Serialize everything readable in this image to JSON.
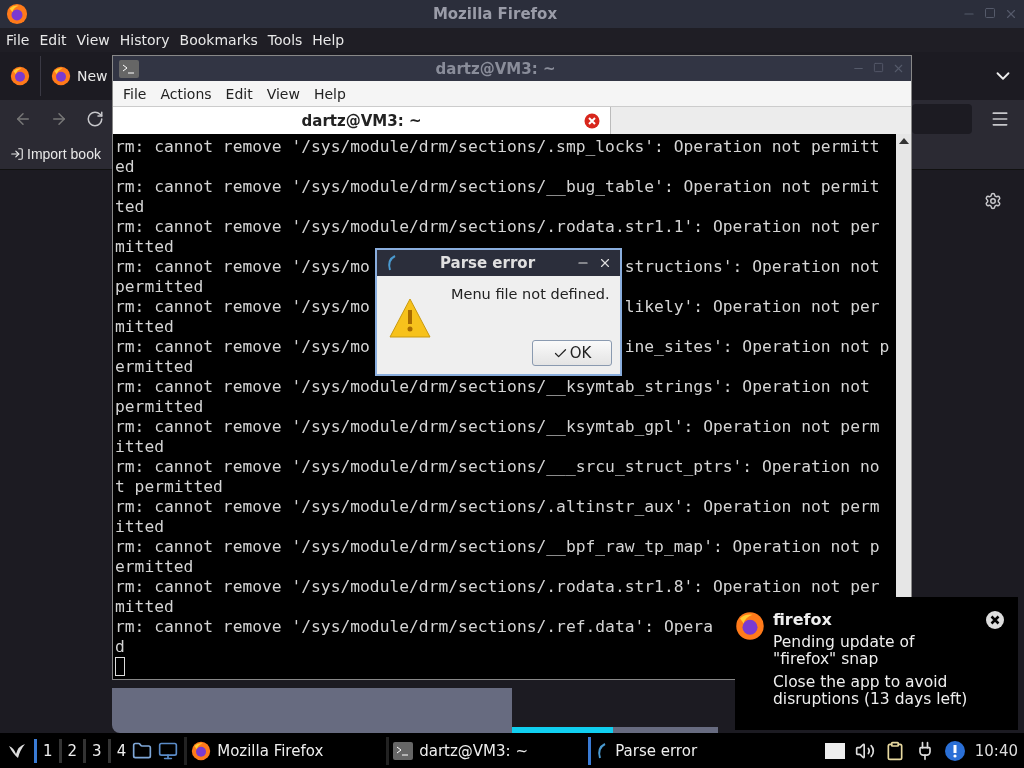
{
  "firefox": {
    "title": "Mozilla Firefox",
    "menu": [
      "File",
      "Edit",
      "View",
      "History",
      "Bookmarks",
      "Tools",
      "Help"
    ],
    "tab": {
      "label": "New"
    },
    "bookmark": "Import book",
    "progress": {
      "level": 0.49
    }
  },
  "terminal": {
    "title": "dartz@VM3: ~",
    "menu": [
      "File",
      "Actions",
      "Edit",
      "View",
      "Help"
    ],
    "tabs": [
      {
        "label": "dartz@VM3: ~",
        "selected": true
      }
    ],
    "lines": [
      {
        "text": "rm: cannot remove '/sys/module/drm/sections/.smp_locks': Operation not permitt"
      },
      {
        "text": "ed"
      },
      {
        "text": "rm: cannot remove '/sys/module/drm/sections/__bug_table': Operation not permit"
      },
      {
        "text": "ted"
      },
      {
        "text": "rm: cannot remove '/sys/module/drm/sections/.rodata.str1.1': Operation not per"
      },
      {
        "text": "mitted"
      },
      {
        "left": "rm: cannot remove '/sys/mo",
        "right": "structions': Operation not"
      },
      {
        "text": "permitted"
      },
      {
        "left": "rm: cannot remove '/sys/mo",
        "right": "likely': Operation not per"
      },
      {
        "text": "mitted"
      },
      {
        "left": "rm: cannot remove '/sys/mo",
        "right": "ine_sites': Operation not p"
      },
      {
        "text": "ermitted"
      },
      {
        "text": "rm: cannot remove '/sys/module/drm/sections/__ksymtab_strings': Operation not"
      },
      {
        "text": "permitted"
      },
      {
        "text": "rm: cannot remove '/sys/module/drm/sections/__ksymtab_gpl': Operation not perm"
      },
      {
        "text": "itted"
      },
      {
        "text": "rm: cannot remove '/sys/module/drm/sections/___srcu_struct_ptrs': Operation no"
      },
      {
        "text": "t permitted"
      },
      {
        "text": "rm: cannot remove '/sys/module/drm/sections/.altinstr_aux': Operation not perm"
      },
      {
        "text": "itted"
      },
      {
        "text": "rm: cannot remove '/sys/module/drm/sections/__bpf_raw_tp_map': Operation not p"
      },
      {
        "text": "ermitted"
      },
      {
        "text": "rm: cannot remove '/sys/module/drm/sections/.rodata.str1.8': Operation not per"
      },
      {
        "text": "mitted"
      },
      {
        "text": "rm: cannot remove '/sys/module/drm/sections/.ref.data': Opera"
      },
      {
        "text": "d"
      }
    ]
  },
  "dialog": {
    "title": "Parse error",
    "message": "Menu file not defined.",
    "button": "OK"
  },
  "notification": {
    "app": "firefox",
    "lines": [
      "Pending update of \"firefox\" snap",
      "Close the app to avoid disruptions (13 days left)"
    ]
  },
  "taskbar": {
    "desktops": [
      {
        "label": "1",
        "selected": true
      },
      {
        "label": "2",
        "selected": false
      },
      {
        "label": "3",
        "selected": false
      },
      {
        "label": "4",
        "selected": false
      }
    ],
    "tasks": [
      {
        "label": "Mozilla Firefox",
        "kind": "firefox",
        "selected": false
      },
      {
        "label": "dartz@VM3: ~",
        "kind": "terminal",
        "selected": false
      },
      {
        "label": "Parse error",
        "kind": "dialog",
        "selected": true
      }
    ],
    "clock": "10:40"
  }
}
